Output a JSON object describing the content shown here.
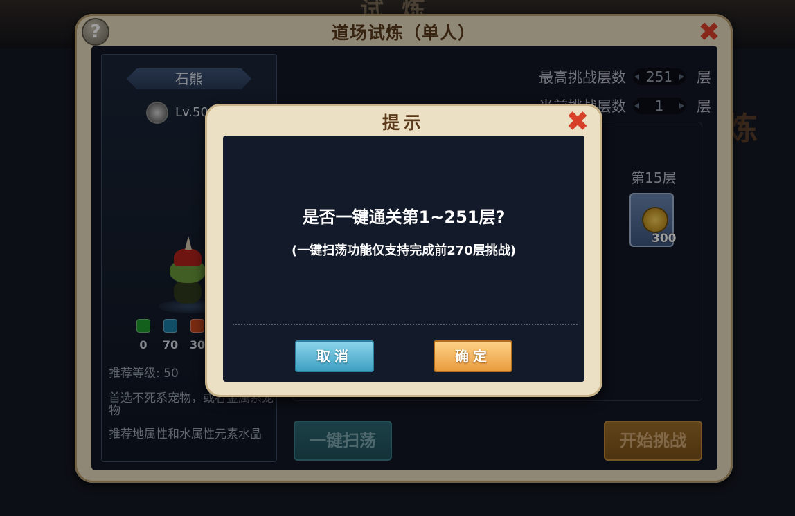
{
  "background": {
    "deco_title": "试炼",
    "deco_right": "炼"
  },
  "panel": {
    "title": "道场试炼（单人）",
    "help_glyph": "?",
    "close_glyph": "✖"
  },
  "pet": {
    "name": "石熊",
    "level": "Lv.50",
    "elements": [
      {
        "value": "0",
        "color": "#1f9a2e"
      },
      {
        "value": "70",
        "color": "#1a7fa6"
      },
      {
        "value": "30",
        "color": "#c4461c"
      }
    ],
    "recommended_level": "推荐等级: 50",
    "tip_pet": "首选不死系宠物，或者金属系宠物",
    "tip_crystal": "推荐地属性和水属性元素水晶"
  },
  "challenge": {
    "max_label": "最高挑战层数",
    "max_value": "251",
    "current_label": "当前挑战层数",
    "current_value": "1",
    "unit": "层",
    "floor_label": "第15层",
    "reward_count": "300"
  },
  "buttons": {
    "sweep": "一键扫荡",
    "start": "开始挑战"
  },
  "dialog": {
    "title": "提示",
    "close_glyph": "✖",
    "question": "是否一键通关第1~251层?",
    "note": "(一键扫荡功能仅支持完成前270层挑战)",
    "cancel": "取消",
    "confirm": "确定"
  }
}
